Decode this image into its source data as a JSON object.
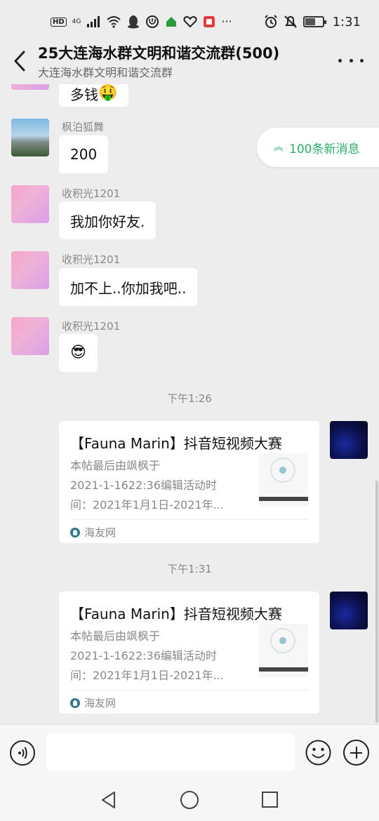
{
  "status_bar": {
    "hd": "HD",
    "network": "4G",
    "time": "1:31",
    "battery_level": 0.6
  },
  "header": {
    "title": "25大连海水群文明和谐交流群(500)",
    "subtitle": "大连海水群文明和谐交流群",
    "back_icon": "chevron-left-icon",
    "more_icon": "more-dots-icon"
  },
  "new_messages": {
    "label": "100条新消息"
  },
  "messages": [
    {
      "sender": "",
      "text": "多钱",
      "emoji": "🤑"
    },
    {
      "sender": "枫泊狐舞",
      "text": "200"
    },
    {
      "sender": "收积光1201",
      "text": "我加你好友."
    },
    {
      "sender": "收积光1201",
      "text": "加不上..你加我吧.."
    },
    {
      "sender": "收积光1201",
      "text": "",
      "emoji": "😎"
    }
  ],
  "timestamps": [
    "下午1:26",
    "下午1:31"
  ],
  "cards": [
    {
      "title": "【Fauna Marin】抖音短视频大赛",
      "desc": [
        "本帖最后由飒枫于",
        "2021-1-1622:36编辑活动时",
        "间：2021年1月1日-2021年..."
      ],
      "source": "海友网"
    },
    {
      "title": "【Fauna Marin】抖音短视频大赛",
      "desc": [
        "本帖最后由飒枫于",
        "2021-1-1622:36编辑活动时",
        "间：2021年1月1日-2021年..."
      ],
      "source": "海友网"
    }
  ],
  "input_bar": {
    "placeholder": "",
    "voice_icon": "voice-icon",
    "emoji_icon": "emoji-icon",
    "plus_icon": "plus-icon"
  },
  "colors": {
    "background": "#ededed",
    "accent_green": "#2aae67"
  }
}
